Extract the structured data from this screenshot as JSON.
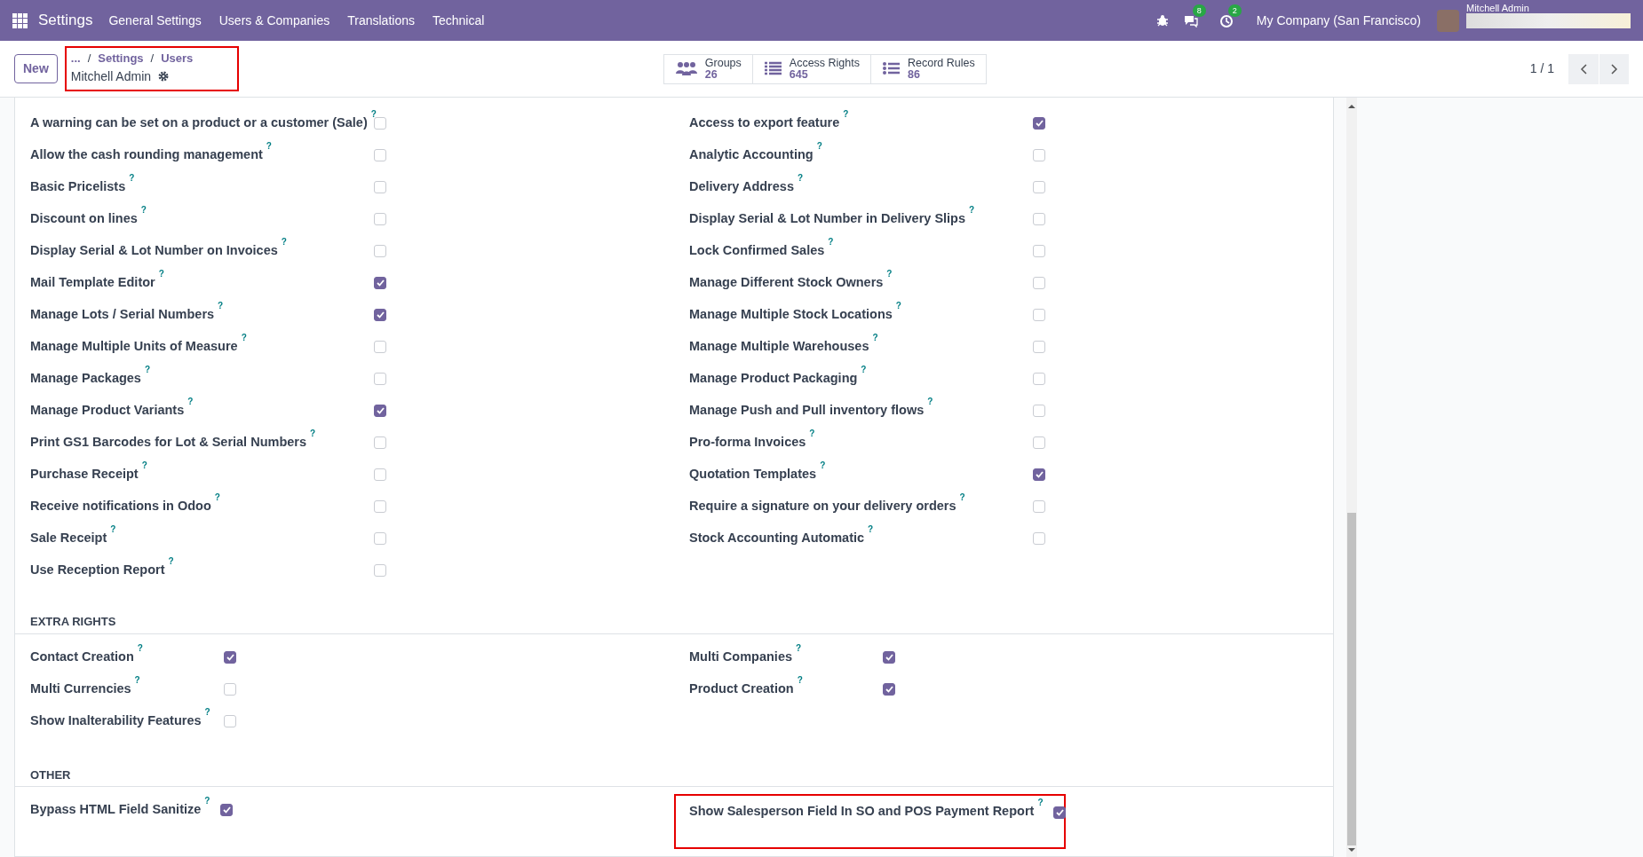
{
  "topbar": {
    "app_name": "Settings",
    "menu": [
      "General Settings",
      "Users & Companies",
      "Translations",
      "Technical"
    ],
    "chat_badge": "8",
    "activity_badge": "2",
    "company": "My Company (San Francisco)",
    "user_name": "Mitchell Admin"
  },
  "control_panel": {
    "new_button": "New",
    "breadcrumb_more": "...",
    "breadcrumb_separator": "/",
    "breadcrumbs": [
      "Settings",
      "Users"
    ],
    "record_name": "Mitchell Admin",
    "highlighted": true,
    "stat_buttons": [
      {
        "kind": "people",
        "label": "Groups",
        "value": "26"
      },
      {
        "kind": "list",
        "label": "Access Rights",
        "value": "645"
      },
      {
        "kind": "bullets",
        "label": "Record Rules",
        "value": "86"
      }
    ],
    "pager": "1 / 1"
  },
  "help_mark": "?",
  "sections": [
    {
      "kind": "wide",
      "left": [
        {
          "label": "A warning can be set on a product or a customer (Sale)",
          "checked": false
        },
        {
          "label": "Allow the cash rounding management",
          "checked": false
        },
        {
          "label": "Basic Pricelists",
          "checked": false
        },
        {
          "label": "Discount on lines",
          "checked": false
        },
        {
          "label": "Display Serial & Lot Number on Invoices",
          "checked": false
        },
        {
          "label": "Mail Template Editor",
          "checked": true
        },
        {
          "label": "Manage Lots / Serial Numbers",
          "checked": true
        },
        {
          "label": "Manage Multiple Units of Measure",
          "checked": false
        },
        {
          "label": "Manage Packages",
          "checked": false
        },
        {
          "label": "Manage Product Variants",
          "checked": true
        },
        {
          "label": "Print GS1 Barcodes for Lot & Serial Numbers",
          "checked": false
        },
        {
          "label": "Purchase Receipt",
          "checked": false
        },
        {
          "label": "Receive notifications in Odoo",
          "checked": false
        },
        {
          "label": "Sale Receipt",
          "checked": false
        },
        {
          "label": "Use Reception Report",
          "checked": false
        }
      ],
      "right": [
        {
          "label": "Access to export feature",
          "checked": true
        },
        {
          "label": "Analytic Accounting",
          "checked": false
        },
        {
          "label": "Delivery Address",
          "checked": false
        },
        {
          "label": "Display Serial & Lot Number in Delivery Slips",
          "checked": false
        },
        {
          "label": "Lock Confirmed Sales",
          "checked": false
        },
        {
          "label": "Manage Different Stock Owners",
          "checked": false
        },
        {
          "label": "Manage Multiple Stock Locations",
          "checked": false
        },
        {
          "label": "Manage Multiple Warehouses",
          "checked": false
        },
        {
          "label": "Manage Product Packaging",
          "checked": false
        },
        {
          "label": "Manage Push and Pull inventory flows",
          "checked": false
        },
        {
          "label": "Pro-forma Invoices",
          "checked": false
        },
        {
          "label": "Quotation Templates",
          "checked": true
        },
        {
          "label": "Require a signature on your delivery orders",
          "checked": false
        },
        {
          "label": "Stock Accounting Automatic",
          "checked": false
        }
      ]
    },
    {
      "kind": "narrow",
      "title": "EXTRA RIGHTS",
      "left": [
        {
          "label": "Contact Creation",
          "checked": true
        },
        {
          "label": "Multi Currencies",
          "checked": false
        },
        {
          "label": "Show Inalterability Features",
          "checked": false
        }
      ],
      "right": [
        {
          "label": "Multi Companies",
          "checked": true
        },
        {
          "label": "Product Creation",
          "checked": true
        }
      ]
    },
    {
      "kind": "inline",
      "title": "OTHER",
      "left": [
        {
          "label": "Bypass HTML Field Sanitize",
          "checked": true
        }
      ],
      "right": [
        {
          "label": "Show Salesperson Field In SO and POS Payment Report",
          "checked": true,
          "highlighted": true
        }
      ]
    }
  ]
}
